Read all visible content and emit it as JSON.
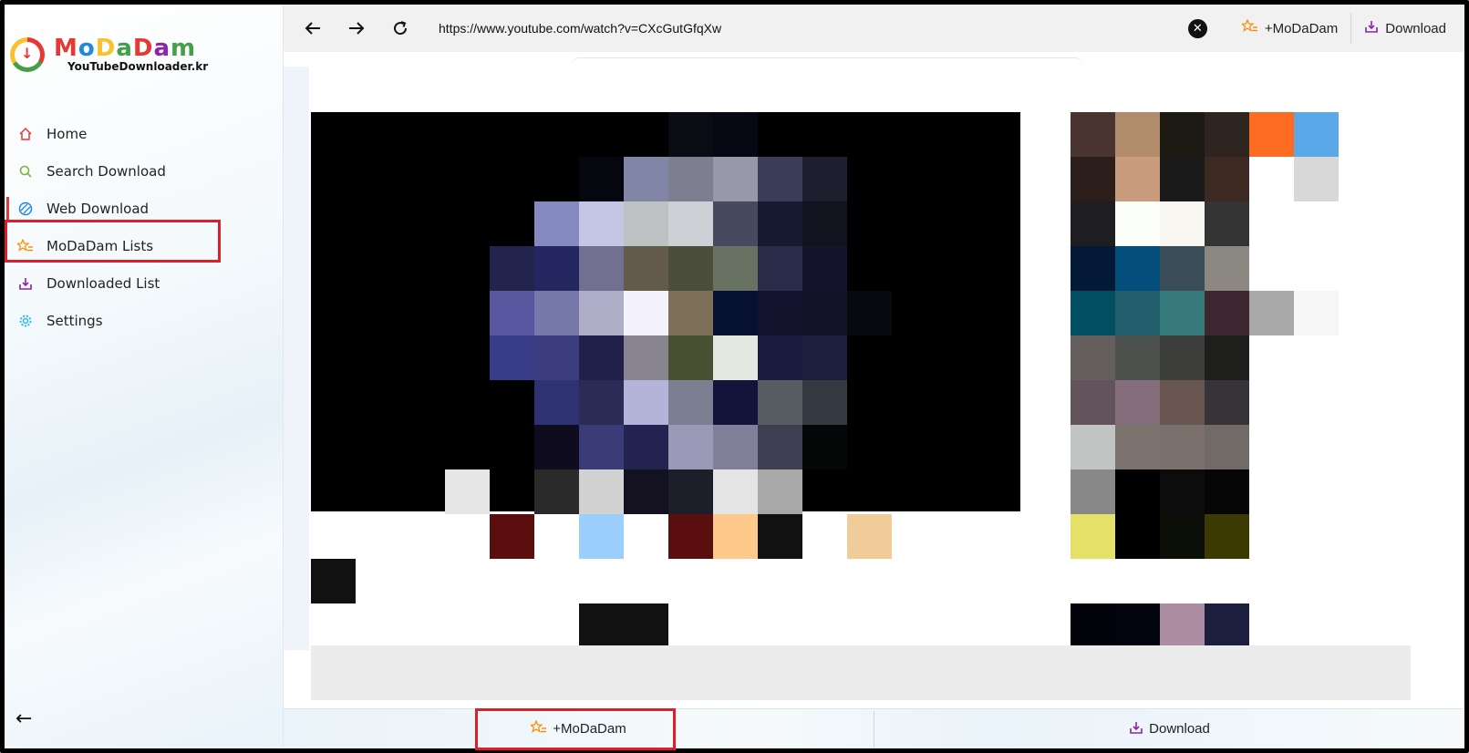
{
  "logo": {
    "word": "MoDaDam",
    "subtitle": "YouTubeDownloader.kr"
  },
  "sidebar": {
    "items": [
      {
        "label": "Home",
        "icon": "home-icon",
        "icon_color": "#e53935"
      },
      {
        "label": "Search Download",
        "icon": "search-icon",
        "icon_color": "#7cb342"
      },
      {
        "label": "Web Download",
        "icon": "globe-icon",
        "icon_color": "#1e88e5"
      },
      {
        "label": "MoDaDam Lists",
        "icon": "star-list-icon",
        "icon_color": "#fb8c00"
      },
      {
        "label": "Downloaded List",
        "icon": "download-tray-icon",
        "icon_color": "#8e24aa"
      },
      {
        "label": "Settings",
        "icon": "gear-icon",
        "icon_color": "#29b6f6"
      }
    ],
    "active_item": "Web Download",
    "highlighted_item": "MoDaDam Lists"
  },
  "toolbar": {
    "url": "https://www.youtube.com/watch?v=CXcGutGfqXw",
    "add_label": "+MoDaDam",
    "download_label": "Download"
  },
  "bottom_bar": {
    "add_label": "+MoDaDam",
    "download_label": "Download"
  },
  "colors": {
    "accent_red": "#e01e2b",
    "toolbar_bg": "#f1f1f1",
    "star_orange": "#fb8c00",
    "download_purple": "#8e24aa"
  }
}
